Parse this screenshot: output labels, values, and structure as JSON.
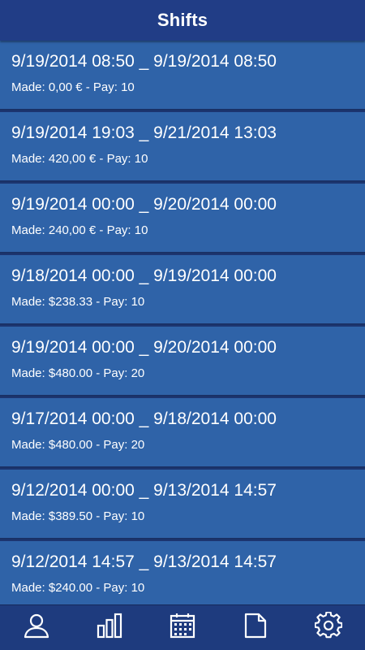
{
  "header": {
    "title": "Shifts"
  },
  "shifts": [
    {
      "range": "9/19/2014 08:50 _ 9/19/2014 08:50",
      "meta": "Made: 0,00 € - Pay: 10"
    },
    {
      "range": "9/19/2014 19:03 _ 9/21/2014 13:03",
      "meta": "Made: 420,00 € - Pay: 10"
    },
    {
      "range": "9/19/2014 00:00 _ 9/20/2014 00:00",
      "meta": "Made: 240,00 € - Pay: 10"
    },
    {
      "range": "9/18/2014 00:00 _ 9/19/2014 00:00",
      "meta": "Made: $238.33 - Pay: 10"
    },
    {
      "range": "9/19/2014 00:00 _ 9/20/2014 00:00",
      "meta": "Made: $480.00 - Pay: 20"
    },
    {
      "range": "9/17/2014 00:00 _ 9/18/2014 00:00",
      "meta": "Made: $480.00 - Pay: 20"
    },
    {
      "range": "9/12/2014 00:00 _ 9/13/2014 14:57",
      "meta": "Made: $389.50 - Pay: 10"
    },
    {
      "range": "9/12/2014 14:57 _ 9/13/2014 14:57",
      "meta": "Made: $240.00 - Pay: 10"
    }
  ],
  "tabbar": {
    "tabs": [
      {
        "icon": "user-icon"
      },
      {
        "icon": "bar-chart-icon"
      },
      {
        "icon": "calendar-icon"
      },
      {
        "icon": "document-icon"
      },
      {
        "icon": "gear-icon"
      }
    ]
  },
  "colors": {
    "header_bg": "#213d86",
    "item_bg": "#2f63a8",
    "divider": "#1a3166",
    "tabbar_bg": "#1e3b7e",
    "text": "#ffffff"
  }
}
